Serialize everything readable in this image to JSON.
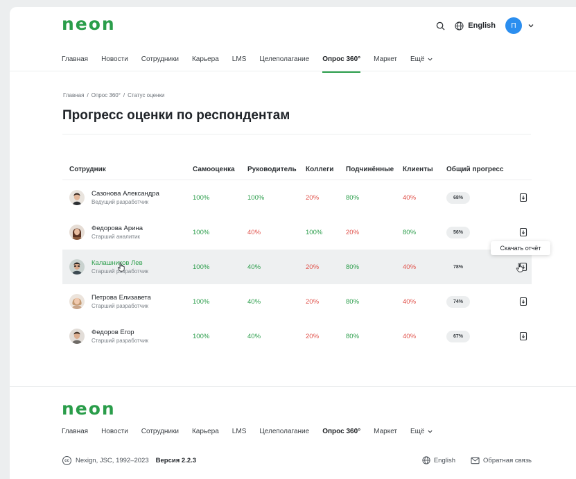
{
  "header": {
    "logo": "neon",
    "language": "English",
    "avatar_initial": "П"
  },
  "nav": {
    "items": [
      "Главная",
      "Новости",
      "Сотрудники",
      "Карьера",
      "LMS",
      "Целеполагание",
      "Опрос 360°",
      "Маркет"
    ],
    "more": "Ещё",
    "active": "Опрос 360°"
  },
  "breadcrumbs": [
    "Главная",
    "Опрос 360°",
    "Статус оценки"
  ],
  "breadcrumb_sep": "/",
  "page_title": "Прогресс оценки по респондентам",
  "table": {
    "columns": {
      "employee": "Сотрудник",
      "self": "Самооценка",
      "manager": "Руководитель",
      "colleagues": "Коллеги",
      "subordinates": "Подчинённые",
      "clients": "Клиенты",
      "progress": "Общий прогресс"
    },
    "rows": [
      {
        "name": "Сазонова Александра",
        "role": "Ведущий разработчик",
        "self": "100%",
        "manager": "100%",
        "colleagues": "20%",
        "subordinates": "80%",
        "clients": "40%",
        "progress": "68%"
      },
      {
        "name": "Федорова Арина",
        "role": "Старший аналитик",
        "self": "100%",
        "manager": "40%",
        "colleagues": "100%",
        "subordinates": "20%",
        "clients": "80%",
        "progress": "56%"
      },
      {
        "name": "Калашников Лев",
        "role": "Старший разработчик",
        "self": "100%",
        "manager": "40%",
        "colleagues": "20%",
        "subordinates": "80%",
        "clients": "40%",
        "progress": "78%"
      },
      {
        "name": "Петрова Елизавета",
        "role": "Старший разработчик",
        "self": "100%",
        "manager": "40%",
        "colleagues": "20%",
        "subordinates": "80%",
        "clients": "40%",
        "progress": "74%"
      },
      {
        "name": "Федоров Егор",
        "role": "Старший разработчик",
        "self": "100%",
        "manager": "40%",
        "colleagues": "20%",
        "subordinates": "80%",
        "clients": "40%",
        "progress": "67%"
      }
    ]
  },
  "tooltip": "Скачать отчёт",
  "footer": {
    "logo": "neon",
    "copyright": "Nexign, JSC, 1992–2023",
    "version": "Версия 2.2.3",
    "language": "English",
    "feedback": "Обратная связь"
  },
  "colors": {
    "brand": "#2a9d4a",
    "positive": "#2a9d4a",
    "negative": "#e0514a",
    "avatar": "#2b8eef"
  }
}
